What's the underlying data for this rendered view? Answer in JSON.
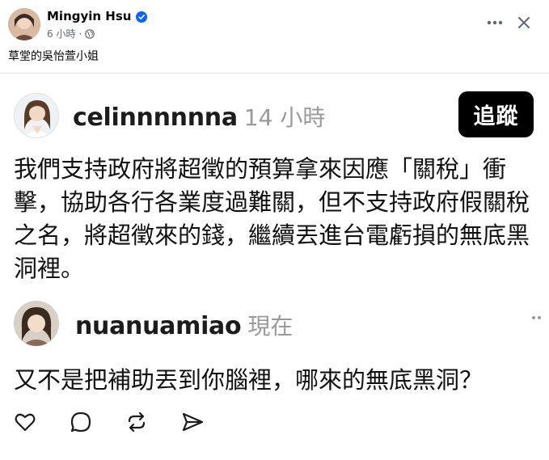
{
  "post": {
    "author": "Mingyin Hsu",
    "time": "6 小時",
    "separator": "·",
    "caption": "草堂的吳怡萱小姐"
  },
  "icons": {
    "verified": "verified-badge-icon",
    "privacy": "globe-icon",
    "more": "more-options-icon",
    "close": "close-icon"
  },
  "threads": {
    "post": {
      "username": "celinnnnnna",
      "time": "14 小時",
      "follow_label": "追蹤",
      "text": "我們支持政府將超徵的預算拿來因應「關稅」衝擊，協助各行各業度過難關，但不支持政府假關稅之名，將超徵來的錢，繼續丟進台電虧損的無底黑洞裡。"
    },
    "reply": {
      "username": "nuanuamiao",
      "time": "現在",
      "text": "又不是把補助丟到你腦裡，哪來的無底黑洞？"
    },
    "actions": [
      "like-icon",
      "comment-icon",
      "repost-icon",
      "share-icon"
    ]
  },
  "colors": {
    "verified_blue": "#0866ff",
    "follow_bg": "#000000",
    "muted_text": "#9a9a9a"
  }
}
